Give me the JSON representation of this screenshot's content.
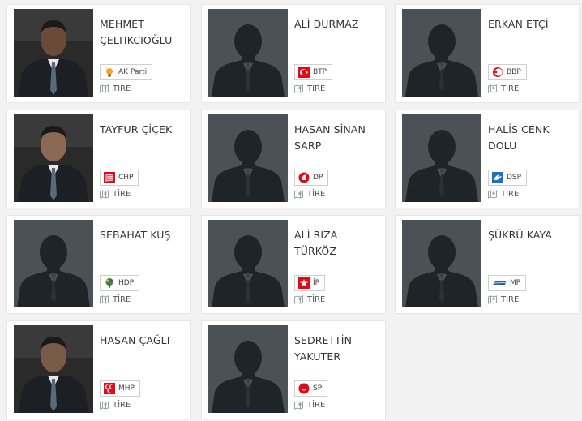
{
  "candidates": [
    {
      "name": "MEHMET ÇELTIKCIOĞLU",
      "party": "AK Parti",
      "party_logo": "akparti-bulb-icon",
      "place": "TİRE",
      "photo": "person-photo",
      "photo_tone": "#6b4a3a"
    },
    {
      "name": "ALİ DURMAZ",
      "party": "BTP",
      "party_logo": "btp-star-crescent-icon",
      "place": "TİRE",
      "photo": "placeholder-silhouette"
    },
    {
      "name": "ERKAN ETÇİ",
      "party": "BBP",
      "party_logo": "bbp-crescent-icon",
      "place": "TİRE",
      "photo": "placeholder-silhouette"
    },
    {
      "name": "TAYFUR ÇİÇEK",
      "party": "CHP",
      "party_logo": "chp-arrows-icon",
      "place": "TİRE",
      "photo": "person-photo",
      "photo_tone": "#8a6a55"
    },
    {
      "name": "HASAN SİNAN SARP",
      "party": "DP",
      "party_logo": "dp-horse-icon",
      "place": "TİRE",
      "photo": "placeholder-silhouette"
    },
    {
      "name": "HALİS CENK DOLU",
      "party": "DSP",
      "party_logo": "dsp-dove-icon",
      "place": "TİRE",
      "photo": "placeholder-silhouette"
    },
    {
      "name": "SEBAHAT KUŞ",
      "party": "HDP",
      "party_logo": "hdp-tree-icon",
      "place": "TİRE",
      "photo": "placeholder-silhouette"
    },
    {
      "name": "ALİ RIZA TÜRKÖZ",
      "party": "İP",
      "party_logo": "ip-star-icon",
      "place": "TİRE",
      "photo": "placeholder-silhouette"
    },
    {
      "name": "ŞÜKRÜ KAYA",
      "party": "MP",
      "party_logo": "mp-flag-icon",
      "place": "TİRE",
      "photo": "placeholder-silhouette"
    },
    {
      "name": "HASAN ÇAĞLI",
      "party": "MHP",
      "party_logo": "mhp-crescents-icon",
      "place": "TİRE",
      "photo": "person-photo",
      "photo_tone": "#7a5a48"
    },
    {
      "name": "SEDRETTİN YAKUTER",
      "party": "SP",
      "party_logo": "sp-crescent-icon",
      "place": "TİRE",
      "photo": "placeholder-silhouette"
    }
  ],
  "colors": {
    "placeholder_bg": "#4a5258",
    "silhouette": "#1f2428",
    "akp": "#f4a81d",
    "red": "#e30a17",
    "dsp_blue": "#1a73c9",
    "mp_blue": "#2b5aa8",
    "hdp_green": "#3a8a3a"
  }
}
